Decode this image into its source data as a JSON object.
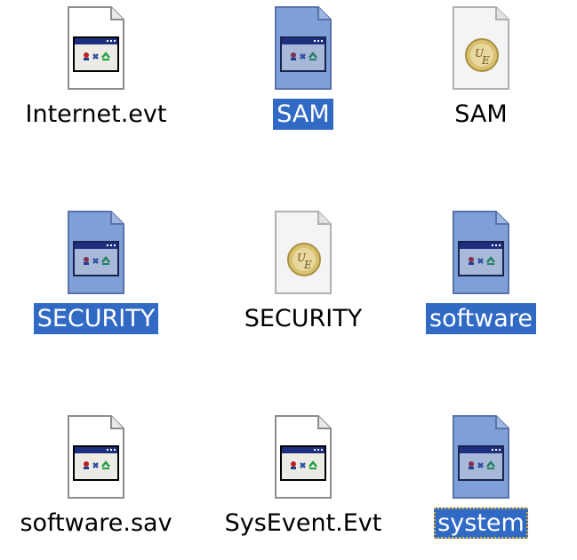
{
  "files": [
    {
      "name": "Internet.evt",
      "icon": "event-log-file-icon",
      "selected": false
    },
    {
      "name": "SAM",
      "icon": "event-log-file-icon",
      "selected": true
    },
    {
      "name": "SAM",
      "icon": "ultraedit-file-icon",
      "selected": false
    },
    {
      "name": "SECURITY",
      "icon": "event-log-file-icon",
      "selected": true
    },
    {
      "name": "SECURITY",
      "icon": "ultraedit-file-icon",
      "selected": false
    },
    {
      "name": "software",
      "icon": "event-log-file-icon",
      "selected": true
    },
    {
      "name": "software.sav",
      "icon": "event-log-file-icon",
      "selected": false
    },
    {
      "name": "SysEvent.Evt",
      "icon": "event-log-file-icon",
      "selected": false
    },
    {
      "name": "system",
      "icon": "event-log-file-icon",
      "selected": true,
      "focused": true
    }
  ],
  "colors": {
    "selection_bg": "#316ac5",
    "selection_text": "#ffffff",
    "selected_icon_tint": "#7f9fd8",
    "focus_outline": "#e0b030"
  }
}
